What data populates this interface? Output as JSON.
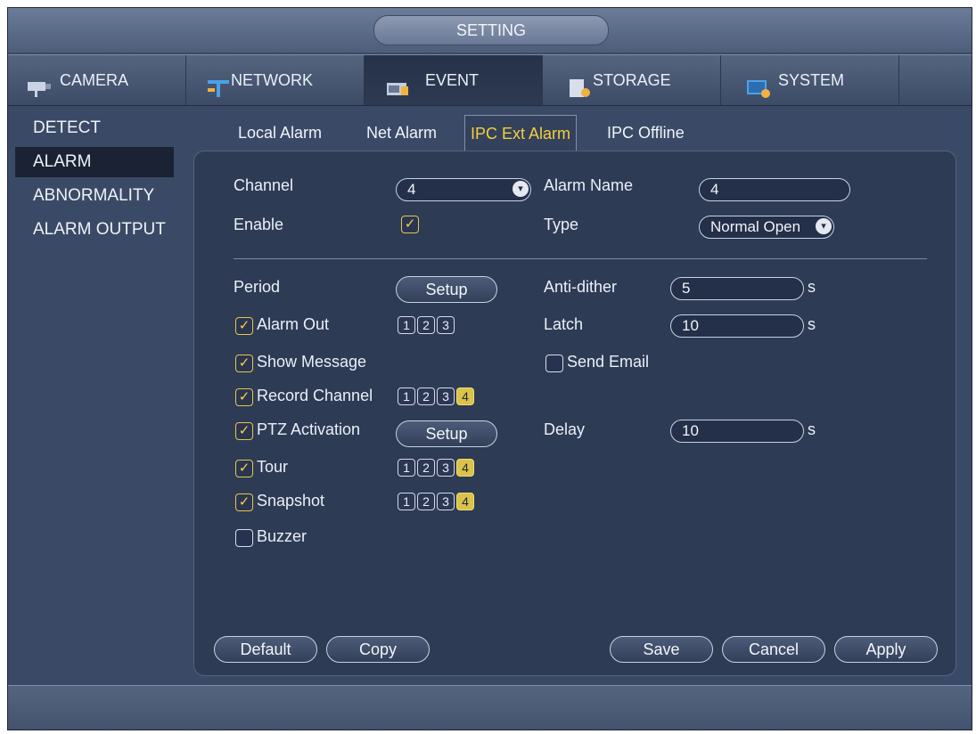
{
  "window": {
    "title": "SETTING"
  },
  "main_tabs": [
    {
      "label": "CAMERA",
      "icon": "camera-icon"
    },
    {
      "label": "NETWORK",
      "icon": "network-icon"
    },
    {
      "label": "EVENT",
      "icon": "event-icon"
    },
    {
      "label": "STORAGE",
      "icon": "storage-icon"
    },
    {
      "label": "SYSTEM",
      "icon": "system-icon"
    }
  ],
  "active_main_tab": "EVENT",
  "sidebar": {
    "items": [
      {
        "label": "DETECT"
      },
      {
        "label": "ALARM"
      },
      {
        "label": "ABNORMALITY"
      },
      {
        "label": "ALARM OUTPUT"
      }
    ],
    "active": "ALARM"
  },
  "sub_tabs": [
    {
      "label": "Local Alarm"
    },
    {
      "label": "Net Alarm"
    },
    {
      "label": "IPC Ext Alarm"
    },
    {
      "label": "IPC Offline"
    }
  ],
  "active_sub_tab": "IPC Ext Alarm",
  "form": {
    "channel": {
      "label": "Channel",
      "value": "4"
    },
    "alarm_name": {
      "label": "Alarm Name",
      "value": "4"
    },
    "enable": {
      "label": "Enable",
      "checked": true
    },
    "type": {
      "label": "Type",
      "value": "Normal Open"
    },
    "period": {
      "label": "Period",
      "button": "Setup"
    },
    "anti_dither": {
      "label": "Anti-dither",
      "value": "5",
      "unit": "s"
    },
    "alarm_out": {
      "label": "Alarm Out",
      "checked": true,
      "numbers": [
        "1",
        "2",
        "3"
      ],
      "selected": []
    },
    "latch": {
      "label": "Latch",
      "value": "10",
      "unit": "s"
    },
    "show_message": {
      "label": "Show Message",
      "checked": true
    },
    "send_email": {
      "label": "Send Email",
      "checked": false
    },
    "record_channel": {
      "label": "Record Channel",
      "checked": true,
      "numbers": [
        "1",
        "2",
        "3",
        "4"
      ],
      "selected": [
        "4"
      ]
    },
    "ptz_activation": {
      "label": "PTZ Activation",
      "checked": true,
      "button": "Setup"
    },
    "delay": {
      "label": "Delay",
      "value": "10",
      "unit": "s"
    },
    "tour": {
      "label": "Tour",
      "checked": true,
      "numbers": [
        "1",
        "2",
        "3",
        "4"
      ],
      "selected": [
        "4"
      ]
    },
    "snapshot": {
      "label": "Snapshot",
      "checked": true,
      "numbers": [
        "1",
        "2",
        "3",
        "4"
      ],
      "selected": [
        "4"
      ]
    },
    "buzzer": {
      "label": "Buzzer",
      "checked": false
    }
  },
  "buttons": {
    "default": "Default",
    "copy": "Copy",
    "save": "Save",
    "cancel": "Cancel",
    "apply": "Apply"
  },
  "check_glyph": "✓",
  "dropdown_glyph": "▾",
  "colors": {
    "accent": "#f5cf3c",
    "panel": "#2e3b55",
    "background": "#3a4a66"
  }
}
